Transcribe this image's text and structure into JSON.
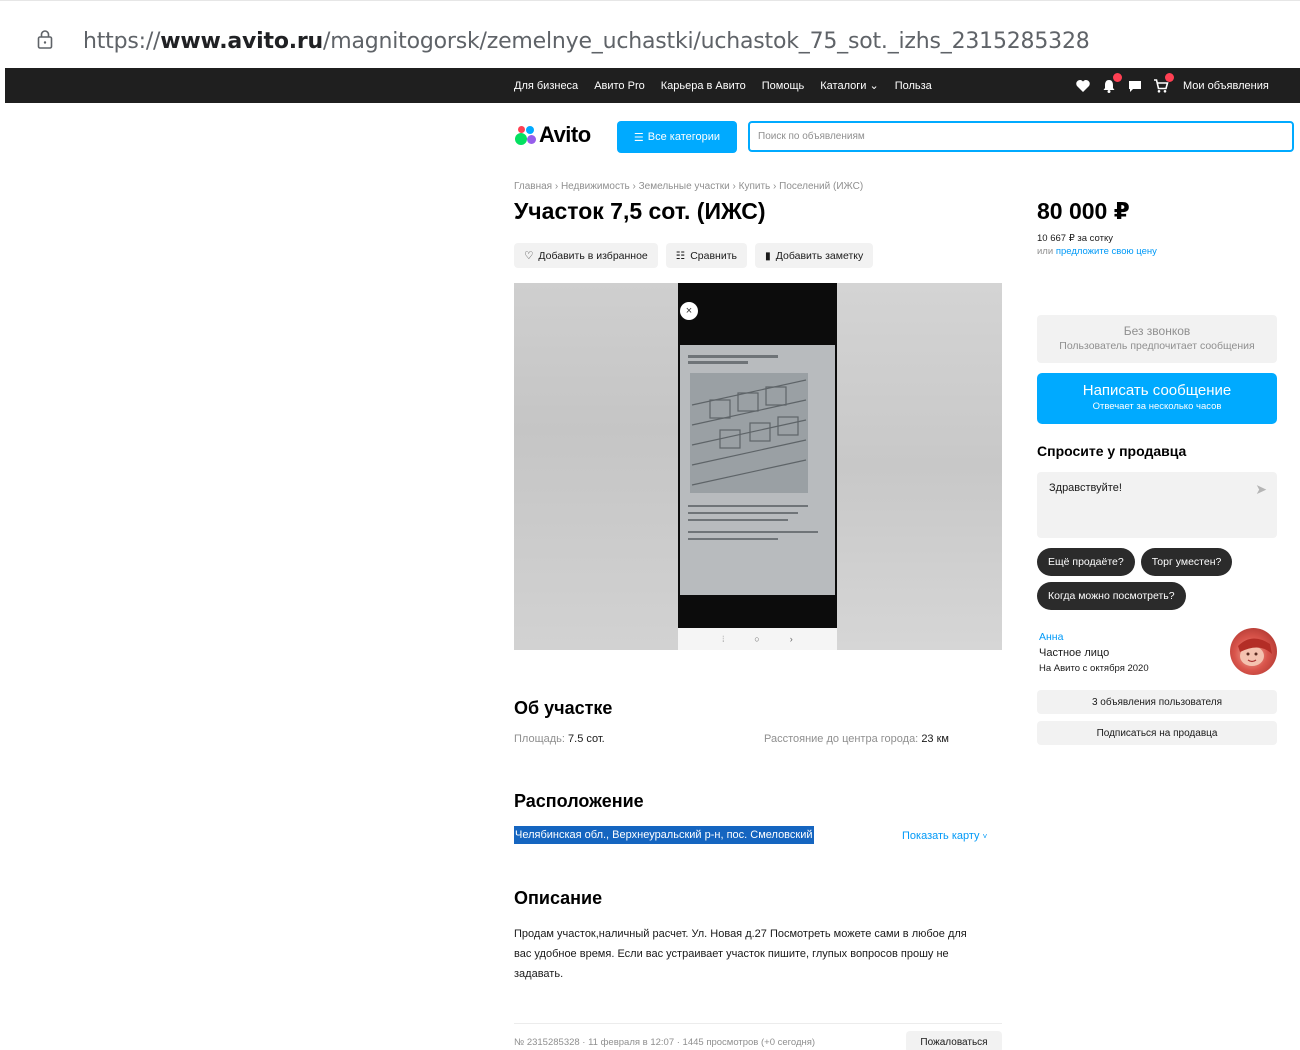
{
  "browser": {
    "url_scheme": "https://",
    "url_host": "www.avito.ru",
    "url_path": "/magnitogorsk/zemelnye_uchastki/uchastok_75_sot._izhs_2315285328"
  },
  "topbar": {
    "links": [
      "Для бизнеса",
      "Авито Pro",
      "Карьера в Авито",
      "Помощь",
      "Каталоги",
      "Польза"
    ],
    "my_ads": "Мои объявления"
  },
  "header": {
    "logo": "Avito",
    "categories_button": "Все категории",
    "search_placeholder": "Поиск по объявлениям"
  },
  "listing": {
    "breadcrumbs": "Главная › Недвижимость › Земельные участки › Купить › Поселений (ИЖС)",
    "title": "Участок 7,5 сот. (ИЖС)",
    "actions": {
      "favorite": "Добавить в избранное",
      "compare": "Сравнить",
      "note": "Добавить заметку"
    },
    "gallery_close": "×",
    "about_heading": "Об участке",
    "params": [
      {
        "label": "Площадь:",
        "value": "7.5 сот."
      },
      {
        "label": "Расстояние до центра города:",
        "value": "23 км"
      }
    ],
    "location_heading": "Расположение",
    "address": "Челябинская обл., Верхнеуральский р-н, пос. Смеловский",
    "show_map": "Показать карту",
    "description_heading": "Описание",
    "description": "Продам участок,наличный расчет. Ул. Новая д.27 Посмотреть можете сами в любое для вас удобное время. Если вас устраивает участок пишите, глупых вопросов прошу не задавать.",
    "meta": "№ 2315285328 · 11 февраля в 12:07 · 1445 просмотров (+0 сегодня)",
    "report": "Пожаловаться"
  },
  "sidebar": {
    "price": "80 000 ₽",
    "price_per": "10 667 ₽ за сотку",
    "offer_prefix": "или",
    "offer_link": "предложите свою цену",
    "no_calls_title": "Без звонков",
    "no_calls_sub": "Пользователь предпочитает сообщения",
    "write_button": "Написать сообщение",
    "write_sub": "Отвечает за несколько часов",
    "ask_heading": "Спросите у продавца",
    "ask_message": "Здравствуйте!",
    "quick_replies": [
      "Ещё продаёте?",
      "Торг уместен?",
      "Когда можно посмотреть?"
    ],
    "seller_name": "Анна",
    "seller_type": "Частное лицо",
    "seller_since": "На Авито с октября 2020",
    "seller_ads_button": "3 объявления пользователя",
    "subscribe_button": "Подписаться на продавца"
  },
  "colors": {
    "accent": "#00aaff",
    "link": "#0099f7",
    "topbar": "#1f1f1f",
    "badge": "#ff4053"
  }
}
